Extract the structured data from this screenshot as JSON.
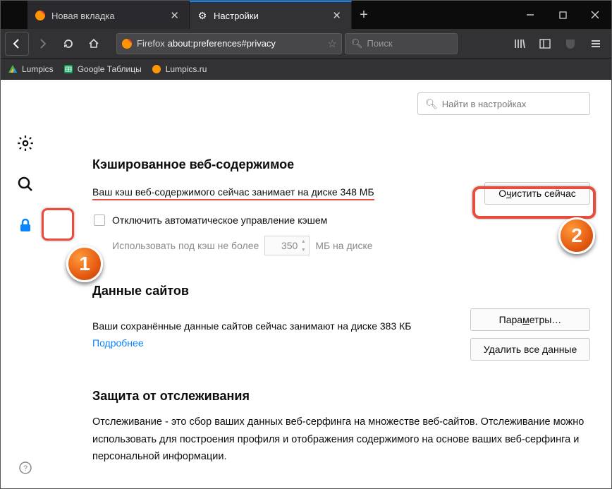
{
  "window": {
    "minimize": "—",
    "maximize": "▢",
    "close": "✕"
  },
  "tabs": [
    {
      "title": "Новая вкладка",
      "active": false
    },
    {
      "title": "Настройки",
      "active": true
    }
  ],
  "newtab": "+",
  "url": {
    "identity": "Firefox",
    "value": "about:preferences#privacy"
  },
  "search_placeholder": "Поиск",
  "bookmarks": [
    {
      "label": "Lumpics"
    },
    {
      "label": "Google Таблицы"
    },
    {
      "label": "Lumpics.ru"
    }
  ],
  "prefs_search_placeholder": "Найти в настройках",
  "cache": {
    "heading": "Кэшированное веб-содержимое",
    "info": "Ваш кэш веб-содержимого сейчас занимает на диске 348 МБ",
    "clear_btn_pre": "О",
    "clear_btn_u": "ч",
    "clear_btn_post": "истить сейчас",
    "override_label": "Отключить автоматическое управление кэшем",
    "limit_pre": "Использовать под кэш не более",
    "limit_value": "350",
    "limit_post": "МБ на диске"
  },
  "site_data": {
    "heading": "Данные сайтов",
    "info": "Ваши сохранённые данные сайтов сейчас занимают на диске 383 КБ",
    "more": "Подробнее",
    "params_pre": "Пара",
    "params_u": "м",
    "params_post": "етры…",
    "delete_all": "Удалить все данные"
  },
  "tracking": {
    "heading": "Защита от отслеживания",
    "desc": "Отслеживание - это сбор ваших данных веб-серфинга на множестве веб-сайтов. Отслеживание можно использовать для построения профиля и отображения содержимого на основе ваших веб-серфинга и персональной информации."
  },
  "annotations": {
    "b1": "1",
    "b2": "2"
  }
}
